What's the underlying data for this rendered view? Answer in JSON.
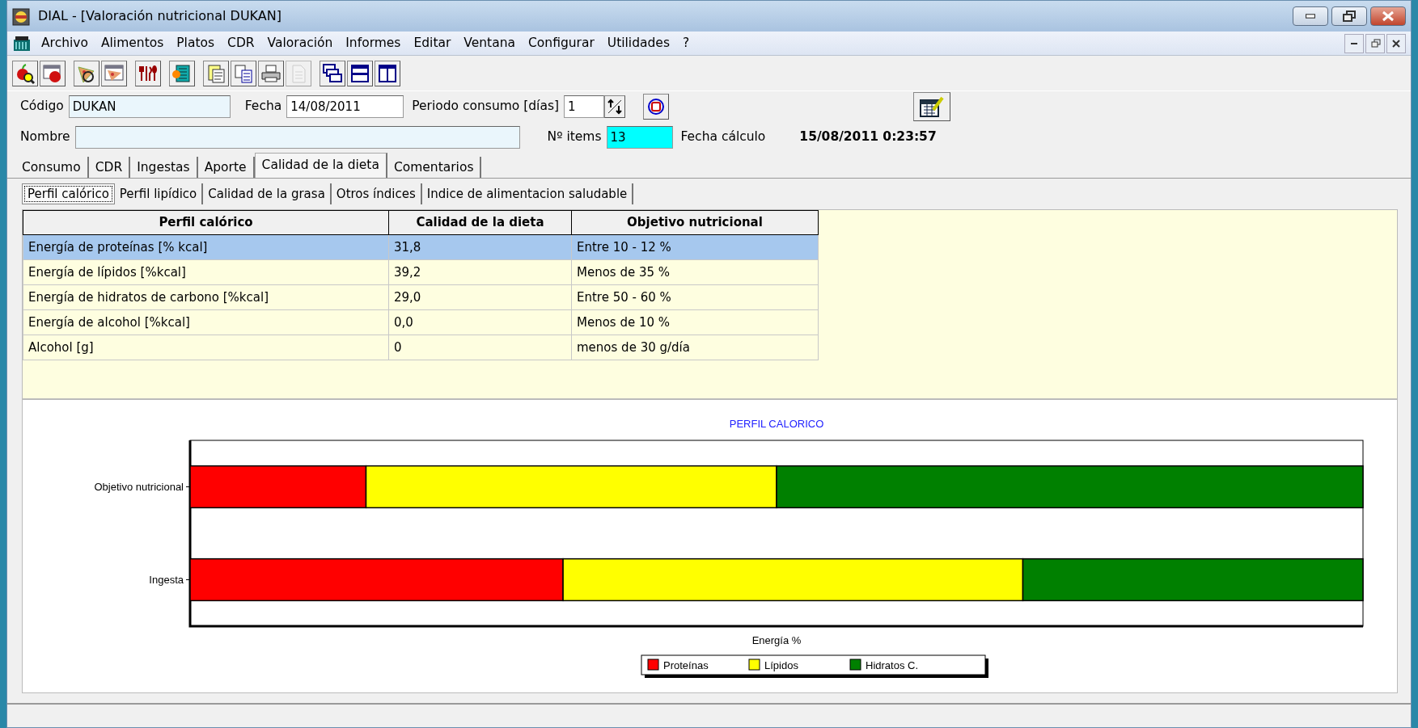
{
  "window": {
    "title": "DIAL - [Valoración nutricional DUKAN]"
  },
  "menu": [
    "Archivo",
    "Alimentos",
    "Platos",
    "CDR",
    "Valoración",
    "Informes",
    "Editar",
    "Ventana",
    "Configurar",
    "Utilidades",
    "?"
  ],
  "toolbar": [
    [
      {
        "kind": "apple-search",
        "disabled": false
      },
      {
        "kind": "apple-window",
        "disabled": false
      }
    ],
    [
      {
        "kind": "pizza-search",
        "disabled": false
      },
      {
        "kind": "pizza-window",
        "disabled": false
      }
    ],
    [
      {
        "kind": "cutlery",
        "disabled": false
      }
    ],
    [
      {
        "kind": "notebook",
        "disabled": false
      }
    ],
    [
      {
        "kind": "report",
        "disabled": false
      },
      {
        "kind": "copy",
        "disabled": false
      },
      {
        "kind": "printer",
        "disabled": false
      },
      {
        "kind": "page",
        "disabled": true
      }
    ],
    [
      {
        "kind": "cascade",
        "disabled": false
      },
      {
        "kind": "tile-horizontal",
        "disabled": false
      },
      {
        "kind": "tile-vertical",
        "disabled": false
      }
    ]
  ],
  "form": {
    "codigo_label": "Código",
    "codigo": "DUKAN",
    "fecha_label": "Fecha",
    "fecha": "14/08/2011",
    "periodo_label": "Periodo consumo [días]",
    "periodo": "1",
    "nombre_label": "Nombre",
    "items_label": "Nº items",
    "items": "13",
    "fecha_calculo_label": "Fecha cálculo",
    "fecha_calculo": "15/08/2011 0:23:57"
  },
  "tabs": [
    {
      "label": "Consumo",
      "selected": false
    },
    {
      "label": "CDR",
      "selected": false
    },
    {
      "label": "Ingestas",
      "selected": false
    },
    {
      "label": "Aporte",
      "selected": false
    },
    {
      "label": "Calidad de la dieta",
      "selected": true
    },
    {
      "label": "Comentarios",
      "selected": false
    }
  ],
  "subtabs": [
    {
      "label": "Perfil calórico",
      "selected": true
    },
    {
      "label": "Perfil lipídico",
      "selected": false
    },
    {
      "label": "Calidad de la grasa",
      "selected": false
    },
    {
      "label": "Otros índices",
      "selected": false
    },
    {
      "label": "Indice de alimentacion saludable",
      "selected": false
    }
  ],
  "table": {
    "columns": [
      "Perfil calórico",
      "Calidad de la dieta",
      "Objetivo nutricional"
    ],
    "rows": [
      {
        "cells": [
          "Energía de proteínas [% kcal]",
          "31,8",
          "Entre 10 - 12 %"
        ],
        "selected": true
      },
      {
        "cells": [
          "Energía de lípidos [%kcal]",
          "39,2",
          "Menos de 35 %"
        ],
        "selected": false
      },
      {
        "cells": [
          "Energía de hidratos de carbono [%kcal]",
          "29,0",
          "Entre 50 - 60 %"
        ],
        "selected": false
      },
      {
        "cells": [
          "Energía de alcohol [%kcal]",
          "0,0",
          "Menos de 10 %"
        ],
        "selected": false
      },
      {
        "cells": [
          "Alcohol [g]",
          "0",
          "menos de 30 g/día"
        ],
        "selected": false
      }
    ]
  },
  "chart": {
    "title": "PERFIL CALORICO",
    "axis_label": "Energía %",
    "categories": [
      "Objetivo nutricional",
      "Ingesta"
    ],
    "legend": [
      {
        "name": "Proteínas",
        "color": "#ff0000"
      },
      {
        "name": "Lípidos",
        "color": "#ffff00"
      },
      {
        "name": "Hidratos C.",
        "color": "#008000"
      }
    ]
  }
}
